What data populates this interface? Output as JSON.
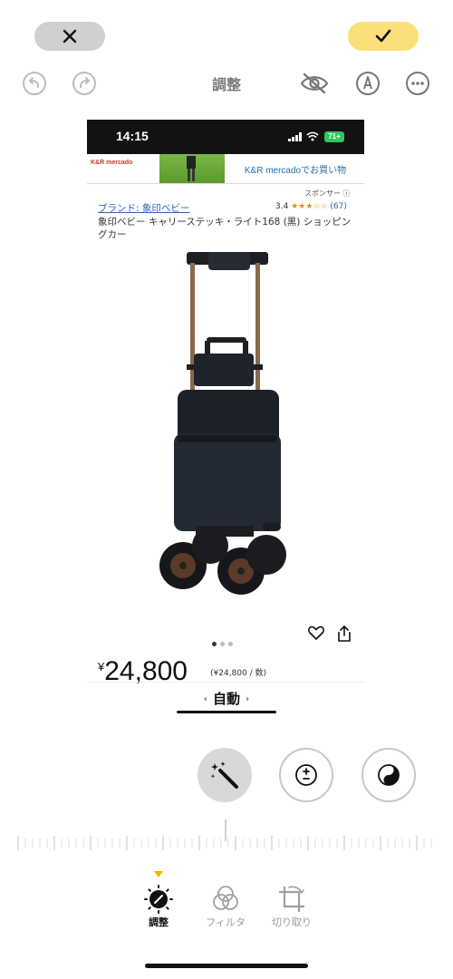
{
  "header": {
    "title": "調整"
  },
  "screenshot": {
    "status_time": "14:15",
    "battery": "71+",
    "banner_logo": "K&R mercado",
    "banner_text": "K&R mercadoでお買い物",
    "sponsor": "スポンサー ⓘ",
    "brand_link": "ブランド: 象印ベビー",
    "rating_value": "3.4",
    "rating_stars": "★★★☆☆",
    "rating_count": "(67)",
    "product_title": "象印ベビー キャリーステッキ・ライト168 (黒) ショッピングカー",
    "price_yen": "¥",
    "price_value": "24,800",
    "price_unit": "(¥24,800 / 数)"
  },
  "adjust": {
    "mode_label": "自動",
    "left_chevron": "‹",
    "right_chevron": "›"
  },
  "tabs": [
    {
      "label": "調整",
      "icon": "adjust-dial-icon",
      "active": true
    },
    {
      "label": "フィルタ",
      "icon": "filter-circles-icon",
      "active": false
    },
    {
      "label": "切り取り",
      "icon": "crop-rotate-icon",
      "active": false
    }
  ],
  "colors": {
    "done_button": "#fbe07a",
    "active_indicator": "#f0b400",
    "link": "#2a68b0"
  }
}
